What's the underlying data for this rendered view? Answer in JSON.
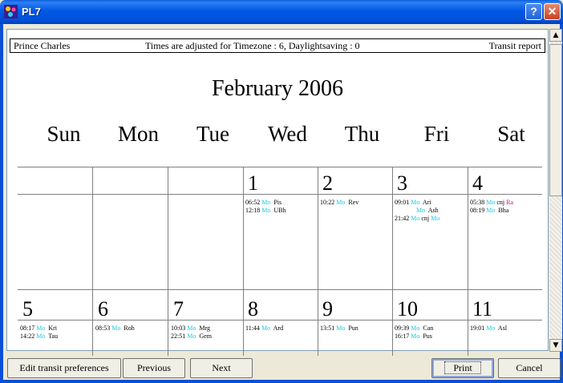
{
  "window": {
    "title": "PL7",
    "help_glyph": "?",
    "close_glyph": "✕"
  },
  "report_header": {
    "name": "Prince Charles",
    "timezone_note": "Times are adjusted for Timezone : 6, Daylightsaving : 0",
    "report_type": "Transit report"
  },
  "calendar": {
    "month_title": "February 2006",
    "day_names": [
      "Sun",
      "Mon",
      "Tue",
      "Wed",
      "Thu",
      "Fri",
      "Sat"
    ],
    "week1": {
      "wed": {
        "day": "1",
        "events": [
          {
            "time": "06:52",
            "planet": "Mo",
            "sign": "Pis"
          },
          {
            "time": "12:18",
            "planet": "Mo",
            "sign": "UBh"
          }
        ]
      },
      "thu": {
        "day": "2",
        "events": [
          {
            "time": "10:22",
            "planet": "Mo",
            "sign": "Rev"
          }
        ]
      },
      "fri": {
        "day": "3",
        "events": [
          {
            "time": "09:01",
            "planet": "Mo",
            "sign": "Ari"
          },
          {
            "time": "",
            "planet": "Mo",
            "sign": "Ash"
          },
          {
            "time": "21:42",
            "planet": "Mo",
            "aspect": "cnj",
            "planet_b": "Mo"
          }
        ]
      },
      "sat": {
        "day": "4",
        "events": [
          {
            "time": "05:38",
            "planet": "Mo",
            "aspect": "cnj",
            "planet_b": "Ra"
          },
          {
            "time": "08:19",
            "planet": "Mo",
            "sign": "Bha"
          }
        ]
      }
    },
    "week2": {
      "sun": {
        "day": "5",
        "events": [
          {
            "time": "08:17",
            "planet": "Mo",
            "sign": "Kri"
          },
          {
            "time": "14:22",
            "planet": "Mo",
            "sign": "Tau"
          }
        ]
      },
      "mon": {
        "day": "6",
        "events": [
          {
            "time": "08:53",
            "planet": "Mo",
            "sign": "Roh"
          }
        ]
      },
      "tue": {
        "day": "7",
        "events": [
          {
            "time": "10:03",
            "planet": "Mo",
            "sign": "Mrg"
          },
          {
            "time": "22:51",
            "planet": "Mo",
            "sign": "Gem"
          }
        ]
      },
      "wed": {
        "day": "8",
        "events": [
          {
            "time": "11:44",
            "planet": "Mo",
            "sign": "Ard"
          }
        ]
      },
      "thu": {
        "day": "9",
        "events": [
          {
            "time": "13:51",
            "planet": "Mo",
            "sign": "Pun"
          }
        ]
      },
      "fri": {
        "day": "10",
        "events": [
          {
            "time": "09:39",
            "planet": "Mo",
            "sign": "Can"
          },
          {
            "time": "16:17",
            "planet": "Mo",
            "sign": "Pus"
          }
        ]
      },
      "sat": {
        "day": "11",
        "events": [
          {
            "time": "19:01",
            "planet": "Mo",
            "sign": "Asl"
          }
        ]
      }
    }
  },
  "buttons": {
    "edit_prefs": "Edit transit preferences",
    "previous": "Previous",
    "next": "Next",
    "print": "Print",
    "cancel": "Cancel"
  },
  "scrollbar": {
    "up_glyph": "▲",
    "down_glyph": "▼"
  },
  "colors": {
    "planet_moon": "#1ec8e0",
    "planet_rahu": "#c0188a",
    "titlebar": "#0058e6"
  }
}
